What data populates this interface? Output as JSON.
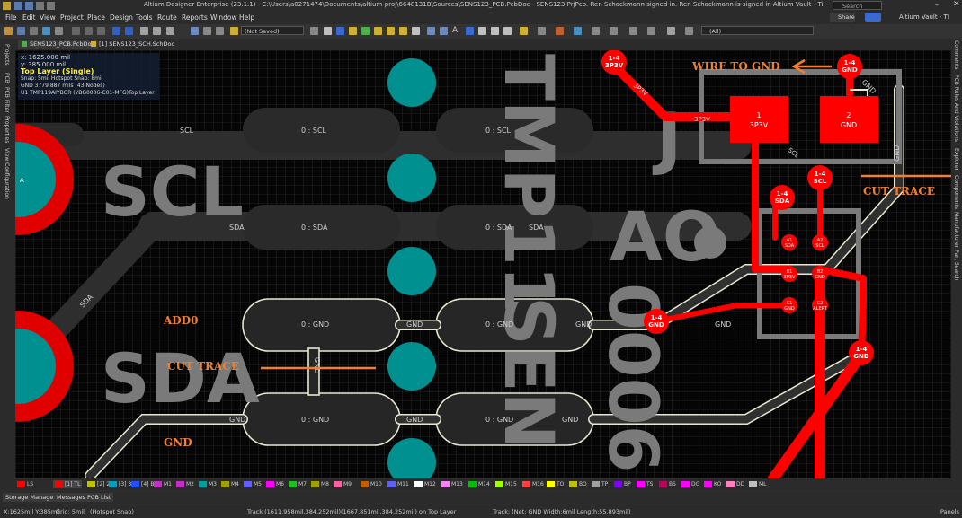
{
  "title": "Altium Designer Enterprise (23.1.1) - C:\\Users\\a0271474\\Documents\\altium-proj\\6648131B\\Sources\\SENS123_PCB.PcbDoc - SENS123.PrjPcb. Ren Schackmann signed in. Ren Schackmann is signed in Altium Vault - Ti.",
  "search_placeholder": "Search",
  "share_label": "Share",
  "vault_label": "Altium Vault - TI",
  "menu": [
    "File",
    "Edit",
    "View",
    "Project",
    "Place",
    "Design",
    "Tools",
    "Route",
    "Reports",
    "Window",
    "Help"
  ],
  "toolbar": {
    "not_saved": "(Not Saved)",
    "filter": "(All)"
  },
  "doc_tabs": [
    "SENS123_PCB.PcbDoc",
    "[1] SENS123_SCH.SchDoc"
  ],
  "left_panels": [
    "Projects",
    "PCB",
    "PCB Filter",
    "Properties",
    "View Configuration"
  ],
  "right_panels": [
    "Comments",
    "PCB Rules And Violations",
    "Explorer",
    "Components",
    "Manufacturer Part Search"
  ],
  "hud": {
    "x": "x:  1625.000  mil",
    "y": "y:   385.000  mil",
    "layer": "Top Layer (Single)",
    "snap": "Snap: 5mil Hotspot Snap: 8mil",
    "net": "GND   3779.887 mils  (43-Nodes)",
    "component": "U1 TMP119AIYBGR (YBG0006-C01-MFG)Top Layer"
  },
  "pcb": {
    "trace_labels": {
      "scl1": "SCL",
      "scl2": "0 : SCL",
      "scl3": "0 : SCL",
      "sda1": "SDA",
      "sda2": "0 : SDA",
      "sda3": "0 : SDA",
      "sda4": "SDA",
      "sda_diag": "SDA",
      "gnd1": "0 : GND",
      "gnd2": "GND",
      "gnd3": "0 : GND",
      "gnd4": "GND",
      "gnd5": "GND",
      "gnd6": "0 : GND",
      "gnd7": "GND",
      "gnd8": "0 : GND",
      "gnd9": "GND",
      "gnd10": "GND",
      "gnd11": "GND",
      "gnd12": "GND",
      "gnd13": "GND",
      "p3v3_1": "3P3V",
      "p3v3_2": "3P3V",
      "scl4": "SCL"
    },
    "silk": {
      "scl": "SCL",
      "sda": "SDA",
      "tmp": "TMP11",
      "ao": "AO",
      "sen": "SEN",
      "s006": "0006",
      "j": "J"
    },
    "annotations": {
      "wire": "WIRE TO GND",
      "cut1": "CUT TRACE",
      "cut2": "CUT TRACE",
      "add0": "ADD0",
      "gnd": "GND"
    },
    "pad1": {
      "num": "1",
      "net": "3P3V"
    },
    "pad2": {
      "num": "2",
      "net": "GND"
    },
    "tp": [
      {
        "id": "1-4",
        "net": "3P3V"
      },
      {
        "id": "1-4",
        "net": "GND"
      },
      {
        "id": "1-4",
        "net": "SCL"
      },
      {
        "id": "1-4",
        "net": "SDA"
      },
      {
        "id": "1-4",
        "net": "GND"
      },
      {
        "id": "1-4",
        "net": "GND"
      }
    ],
    "bga": [
      {
        "id": "A1",
        "net": "SDA"
      },
      {
        "id": "A2",
        "net": "SCL"
      },
      {
        "id": "B1",
        "net": "3P3V"
      },
      {
        "id": "B2",
        "net": "GND"
      },
      {
        "id": "C1",
        "net": "GND"
      },
      {
        "id": "C2",
        "net": "ALERT"
      }
    ],
    "big_pad_left": "A"
  },
  "layers": [
    {
      "name": "LS",
      "color": "#ff0000"
    },
    {
      "name": "[1] TL",
      "color": "#ff0000"
    },
    {
      "name": "[2] 2",
      "color": "#c0c000"
    },
    {
      "name": "[3] 3",
      "color": "#00a0c0"
    },
    {
      "name": "[4] BL",
      "color": "#2050ff"
    },
    {
      "name": "M1",
      "color": "#c030c0"
    },
    {
      "name": "M2",
      "color": "#c030c0"
    },
    {
      "name": "M3",
      "color": "#00a0a0"
    },
    {
      "name": "M4",
      "color": "#a0a000"
    },
    {
      "name": "M5",
      "color": "#6060ff"
    },
    {
      "name": "M6",
      "color": "#ff00ff"
    },
    {
      "name": "M7",
      "color": "#20c020"
    },
    {
      "name": "M8",
      "color": "#a0a000"
    },
    {
      "name": "M9",
      "color": "#ff60a0"
    },
    {
      "name": "M10",
      "color": "#c06000"
    },
    {
      "name": "M11",
      "color": "#6060ff"
    },
    {
      "name": "M12",
      "color": "#ffffff"
    },
    {
      "name": "M13",
      "color": "#ff80ff"
    },
    {
      "name": "M14",
      "color": "#00c000"
    },
    {
      "name": "M15",
      "color": "#a0ff00"
    },
    {
      "name": "M16",
      "color": "#ff4040"
    },
    {
      "name": "TO",
      "color": "#ffff00"
    },
    {
      "name": "BO",
      "color": "#c0c000"
    },
    {
      "name": "TP",
      "color": "#a0a0a0"
    },
    {
      "name": "BP",
      "color": "#8000ff"
    },
    {
      "name": "TS",
      "color": "#ff00ff"
    },
    {
      "name": "BS",
      "color": "#c00060"
    },
    {
      "name": "DG",
      "color": "#ff00ff"
    },
    {
      "name": "KO",
      "color": "#ff00ff"
    },
    {
      "name": "DD",
      "color": "#ff80c0"
    },
    {
      "name": "ML",
      "color": "#c0c0c0"
    }
  ],
  "bottom_tabs": [
    "Storage Manager",
    "Messages",
    "PCB List"
  ],
  "status": {
    "coords": "X:1625mil Y:385mil",
    "grid": "Grid: 5mil",
    "snap": "(Hotspot Snap)",
    "track1": "Track (1611.958mil,384.252mil)(1667.851mil,384.252mil) on Top Layer",
    "track2": "Track: (Net: GND Width:6mil Length:55.893mil)",
    "panels": "Panels"
  }
}
